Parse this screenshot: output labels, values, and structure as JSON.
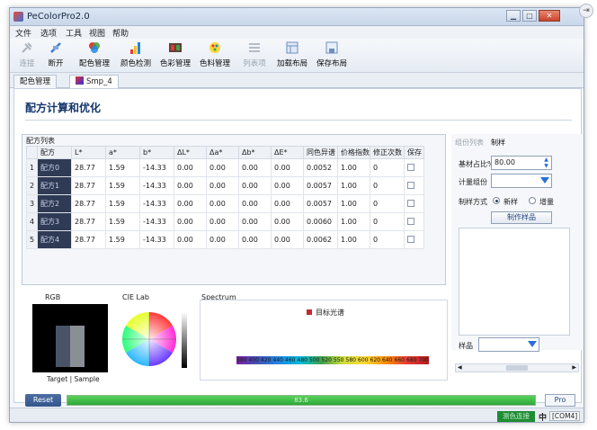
{
  "window": {
    "title": "PeColorPro2.0"
  },
  "menu": [
    "文件",
    "选项",
    "工具",
    "视图",
    "帮助"
  ],
  "toolbar": [
    {
      "label": "连接",
      "icon": "plug-icon",
      "enabled": false
    },
    {
      "label": "断开",
      "icon": "unplug-icon",
      "enabled": true
    },
    {
      "label": "配色管理",
      "icon": "color-palette-icon",
      "enabled": true
    },
    {
      "label": "颜色检测",
      "icon": "color-detect-icon",
      "enabled": true
    },
    {
      "label": "色彩管理",
      "icon": "color-manage-icon",
      "enabled": true
    },
    {
      "label": "色料管理",
      "icon": "pigment-icon",
      "enabled": true
    },
    {
      "label": "列表项",
      "icon": "list-icon",
      "enabled": false
    },
    {
      "label": "加载布局",
      "icon": "load-layout-icon",
      "enabled": true
    },
    {
      "label": "保存布局",
      "icon": "save-layout-icon",
      "enabled": true
    }
  ],
  "tabs": [
    {
      "label": "配色管理"
    },
    {
      "label": "Smp_4"
    }
  ],
  "page": {
    "title": "配方计算和优化"
  },
  "formula_list": {
    "label": "配方列表",
    "columns": [
      "配方",
      "L*",
      "a*",
      "b*",
      "ΔL*",
      "Δa*",
      "Δb*",
      "ΔE*",
      "同色异谱",
      "价格指数",
      "修正次数",
      "保存"
    ],
    "rows": [
      {
        "n": "1",
        "name": "配方0",
        "L": "28.77",
        "a": "1.59",
        "b": "-14.33",
        "dL": "0.00",
        "da": "0.00",
        "db": "0.00",
        "dE": "0.00",
        "meta": "0.0052",
        "price": "1.00",
        "fix": "0"
      },
      {
        "n": "2",
        "name": "配方1",
        "L": "28.77",
        "a": "1.59",
        "b": "-14.33",
        "dL": "0.00",
        "da": "0.00",
        "db": "0.00",
        "dE": "0.00",
        "meta": "0.0057",
        "price": "1.00",
        "fix": "0"
      },
      {
        "n": "3",
        "name": "配方2",
        "L": "28.77",
        "a": "1.59",
        "b": "-14.33",
        "dL": "0.00",
        "da": "0.00",
        "db": "0.00",
        "dE": "0.00",
        "meta": "0.0057",
        "price": "1.00",
        "fix": "0"
      },
      {
        "n": "4",
        "name": "配方3",
        "L": "28.77",
        "a": "1.59",
        "b": "-14.33",
        "dL": "0.00",
        "da": "0.00",
        "db": "0.00",
        "dE": "0.00",
        "meta": "0.0060",
        "price": "1.00",
        "fix": "0"
      },
      {
        "n": "5",
        "name": "配方4",
        "L": "28.77",
        "a": "1.59",
        "b": "-14.33",
        "dL": "0.00",
        "da": "0.00",
        "db": "0.00",
        "dE": "0.00",
        "meta": "0.0062",
        "price": "1.00",
        "fix": "0"
      }
    ]
  },
  "right_panel": {
    "tab_list": "组份列表",
    "tab_make": "制样",
    "base_ratio_label": "基材占比%",
    "base_ratio_value": "80.00",
    "meter_label": "计量组份",
    "method_label": "制样方式",
    "radio_new": "新样",
    "radio_add": "增量",
    "make_button": "制作样品",
    "sample_label": "样品"
  },
  "bottom": {
    "rgb_label": "RGB",
    "target_sample": "Target | Sample",
    "cie_label": "CIE Lab",
    "spectrum_label": "Spectrum",
    "spectrum_legend": "目标光谱",
    "spectrum_ticks": [
      "380",
      "400",
      "420",
      "440",
      "460",
      "480",
      "500",
      "520",
      "550",
      "580",
      "600",
      "620",
      "640",
      "660",
      "680",
      "700"
    ]
  },
  "controls": {
    "reset": "Reset",
    "pro": "Pro",
    "progress_text": "83.6",
    "progress_fraction": 1.0
  },
  "status": {
    "connected": "测色连接",
    "ime": "中",
    "port": "[COM4]"
  },
  "colors": {
    "accent": "#14356b",
    "progress": "#2ea83a",
    "status_green": "#1e8c34"
  }
}
